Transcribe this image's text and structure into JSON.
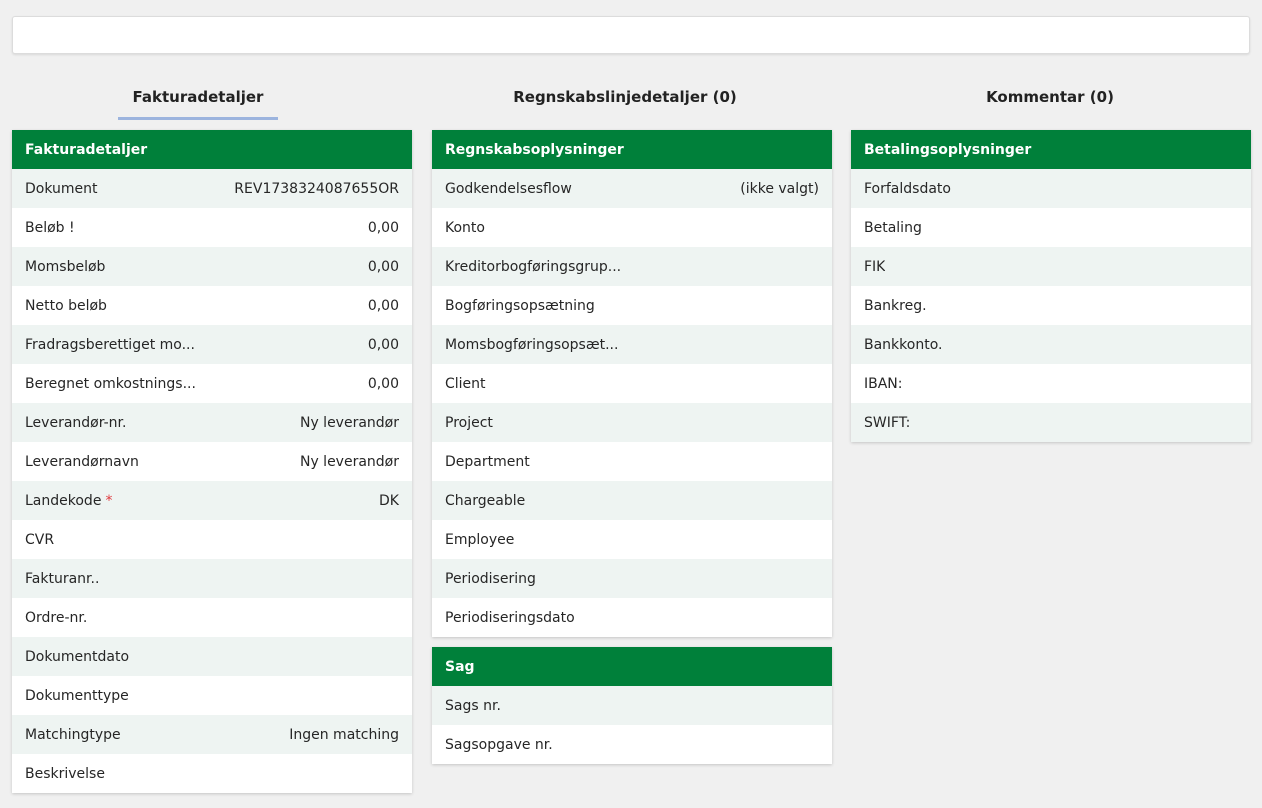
{
  "tabs": [
    {
      "label": "Fakturadetaljer",
      "count": null,
      "active": true
    },
    {
      "label": "Regnskabslinjedetaljer",
      "count": "0",
      "active": false
    },
    {
      "label": "Kommentar",
      "count": "0",
      "active": false
    }
  ],
  "faktura": {
    "title": "Fakturadetaljer",
    "rows": [
      {
        "label": "Dokument",
        "value": "REV1738324087655OR"
      },
      {
        "label": "Beløb !",
        "value": "0,00"
      },
      {
        "label": "Momsbeløb",
        "value": "0,00"
      },
      {
        "label": "Netto beløb",
        "value": "0,00"
      },
      {
        "label": "Fradragsberettiget mo...",
        "value": "0,00"
      },
      {
        "label": "Beregnet omkostnings...",
        "value": "0,00"
      },
      {
        "label": "Leverandør-nr.",
        "value": "Ny leverandør"
      },
      {
        "label": "Leverandørnavn",
        "value": "Ny leverandør"
      },
      {
        "label": "Landekode",
        "required": "*",
        "value": "DK"
      },
      {
        "label": "CVR",
        "value": ""
      },
      {
        "label": "Fakturanr..",
        "value": ""
      },
      {
        "label": "Ordre-nr.",
        "value": ""
      },
      {
        "label": "Dokumentdato",
        "value": ""
      },
      {
        "label": "Dokumenttype",
        "value": ""
      },
      {
        "label": "Matchingtype",
        "value": "Ingen matching"
      },
      {
        "label": "Beskrivelse",
        "value": ""
      }
    ]
  },
  "regnskab": {
    "title": "Regnskabsoplysninger",
    "rows": [
      {
        "label": "Godkendelsesflow",
        "value": "(ikke valgt)"
      },
      {
        "label": "Konto",
        "value": ""
      },
      {
        "label": "Kreditorbogføringsgrup...",
        "value": ""
      },
      {
        "label": "Bogføringsopsætning",
        "value": ""
      },
      {
        "label": "Momsbogføringsopsæt...",
        "value": ""
      },
      {
        "label": "Client",
        "value": ""
      },
      {
        "label": "Project",
        "value": ""
      },
      {
        "label": "Department",
        "value": ""
      },
      {
        "label": "Chargeable",
        "value": ""
      },
      {
        "label": "Employee",
        "value": ""
      },
      {
        "label": "Periodisering",
        "value": ""
      },
      {
        "label": "Periodiseringsdato",
        "value": ""
      }
    ]
  },
  "sag": {
    "title": "Sag",
    "rows": [
      {
        "label": "Sags nr.",
        "value": ""
      },
      {
        "label": "Sagsopgave nr.",
        "value": ""
      }
    ]
  },
  "betaling": {
    "title": "Betalingsoplysninger",
    "rows": [
      {
        "label": "Forfaldsdato",
        "value": ""
      },
      {
        "label": "Betaling",
        "value": ""
      },
      {
        "label": "FIK",
        "value": ""
      },
      {
        "label": "Bankreg.",
        "value": ""
      },
      {
        "label": "Bankkonto.",
        "value": ""
      },
      {
        "label": "IBAN:",
        "value": ""
      },
      {
        "label": "SWIFT:",
        "value": ""
      }
    ]
  },
  "colors": {
    "header_green": "#00803a",
    "row_stripe": "#eef4f2",
    "tab_underline": "#9cb4de",
    "required": "#e0393e"
  }
}
